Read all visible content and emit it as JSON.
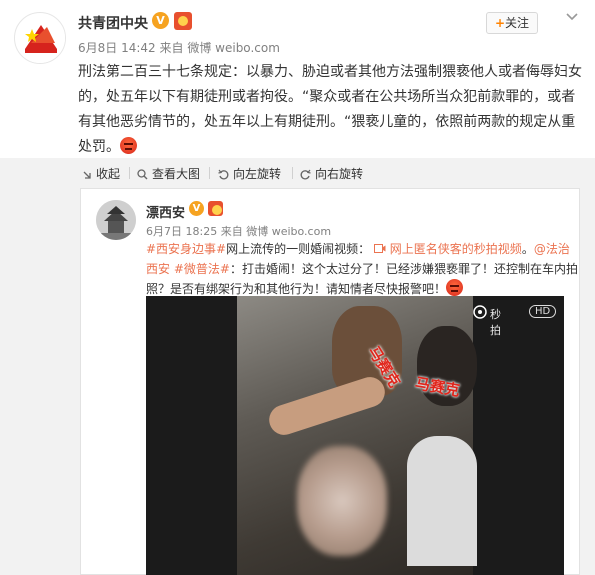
{
  "post": {
    "author": "共青团中央",
    "verified_badge": "V",
    "date": "6月8日 14:42",
    "source_prefix": "来自",
    "source": "微博 weibo.com",
    "follow_label": "关注",
    "text": "刑法第二百三十七条规定：以暴力、胁迫或者其他方法强制猥亵他人或者侮辱妇女的，处五年以下有期徒刑或者拘役。“聚众或者在公共场所当众犯前款罪的，或者有其他恶劣情节的，处五年以上有期徒刑。“猥亵儿童的，依照前两款的规定从重处罚。",
    "emoji": "angry-emoji"
  },
  "toolbar": {
    "collapse": "收起",
    "view_large": "查看大图",
    "rotate_left": "向左旋转",
    "rotate_right": "向右旋转"
  },
  "repost": {
    "author": "漂西安",
    "verified_badge": "V",
    "date": "6月7日 18:25",
    "source_prefix": "来自",
    "source": "微博 weibo.com",
    "tag1": "#西安身边事#",
    "text1": "网上流传的一则婚闹视频：",
    "link": "网上匿名侠客的秒拍视频",
    "sep": "。",
    "mention": "@法治西安",
    "tag2": "#微普法#",
    "text2": "：打击婚闹！这个太过分了！已经涉嫌猥亵罪了！还控制在车内拍照？是否有绑架行为和其他行为！请知情者尽快报警吧！"
  },
  "video": {
    "watermark": "秒拍",
    "hd": "HD",
    "label_left": "马赛克",
    "label_right": "马赛克"
  },
  "colors": {
    "accent": "#eb7350",
    "follow_plus": "#ff8200",
    "verified": "#f6a321",
    "mosaic_text": "#e0261c"
  }
}
